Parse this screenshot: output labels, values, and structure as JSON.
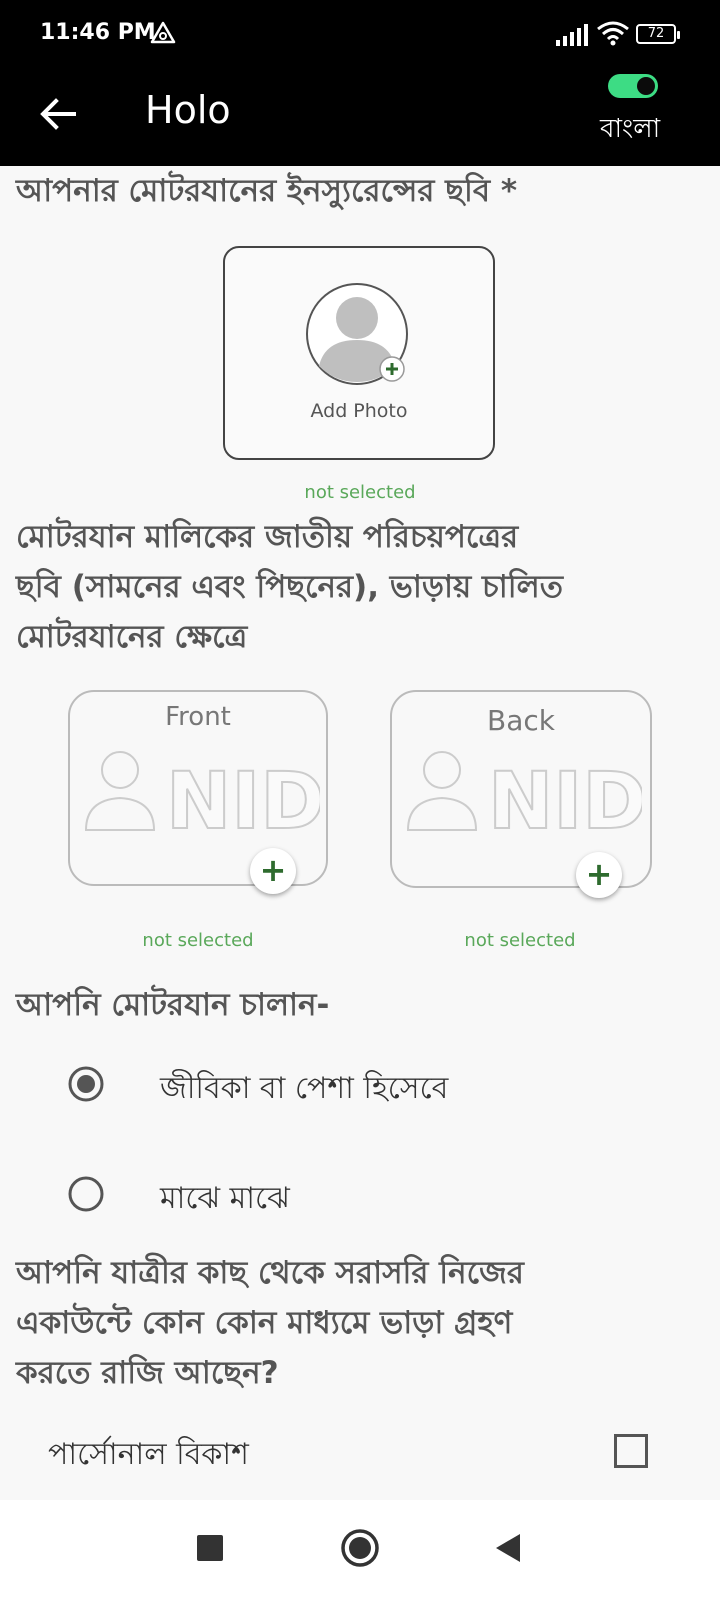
{
  "status_bar": {
    "time": "11:46 PM",
    "battery": "72",
    "icons": [
      "alert-triangle-icon",
      "signal-icon",
      "wifi-icon",
      "battery-icon"
    ]
  },
  "app_bar": {
    "title": "Holo",
    "language_label": "বাংলা",
    "language_toggle_on": true,
    "toggle_color": "#3ddc84"
  },
  "insurance": {
    "title": "আপনার মোটরযানের ইনস্যুরেন্সের ছবি *",
    "add_photo_label": "Add Photo",
    "status": "not selected"
  },
  "nid": {
    "title_line1": "মোটরযান মালিকের জাতীয় পরিচয়পত্রের",
    "title_line2": "ছবি (সামনের এবং পিছনের), ভাড়ায় চালিত",
    "title_line3": "মোটরযানের ক্ষেত্রে",
    "front_label": "Front",
    "back_label": "Back",
    "card_text": "NID",
    "front_status": "not selected",
    "back_status": "not selected"
  },
  "drive_question": {
    "title": "আপনি মোটরযান চালান-",
    "options": [
      {
        "label": "জীবিকা বা পেশা হিসেবে",
        "selected": true
      },
      {
        "label": "মাঝে মাঝে",
        "selected": false
      }
    ]
  },
  "payment_question": {
    "title_line1": "আপনি যাত্রীর কাছ থেকে সরাসরি নিজের",
    "title_line2": "একাউন্টে কোন কোন মাধ্যমে ভাড়া গ্রহণ",
    "title_line3": "করতে রাজি আছেন?",
    "options": [
      {
        "label": "পার্সোনাল বিকাশ",
        "checked": false
      }
    ]
  },
  "colors": {
    "status_green": "#5aa85a",
    "plus_green": "#2e6b2e"
  }
}
